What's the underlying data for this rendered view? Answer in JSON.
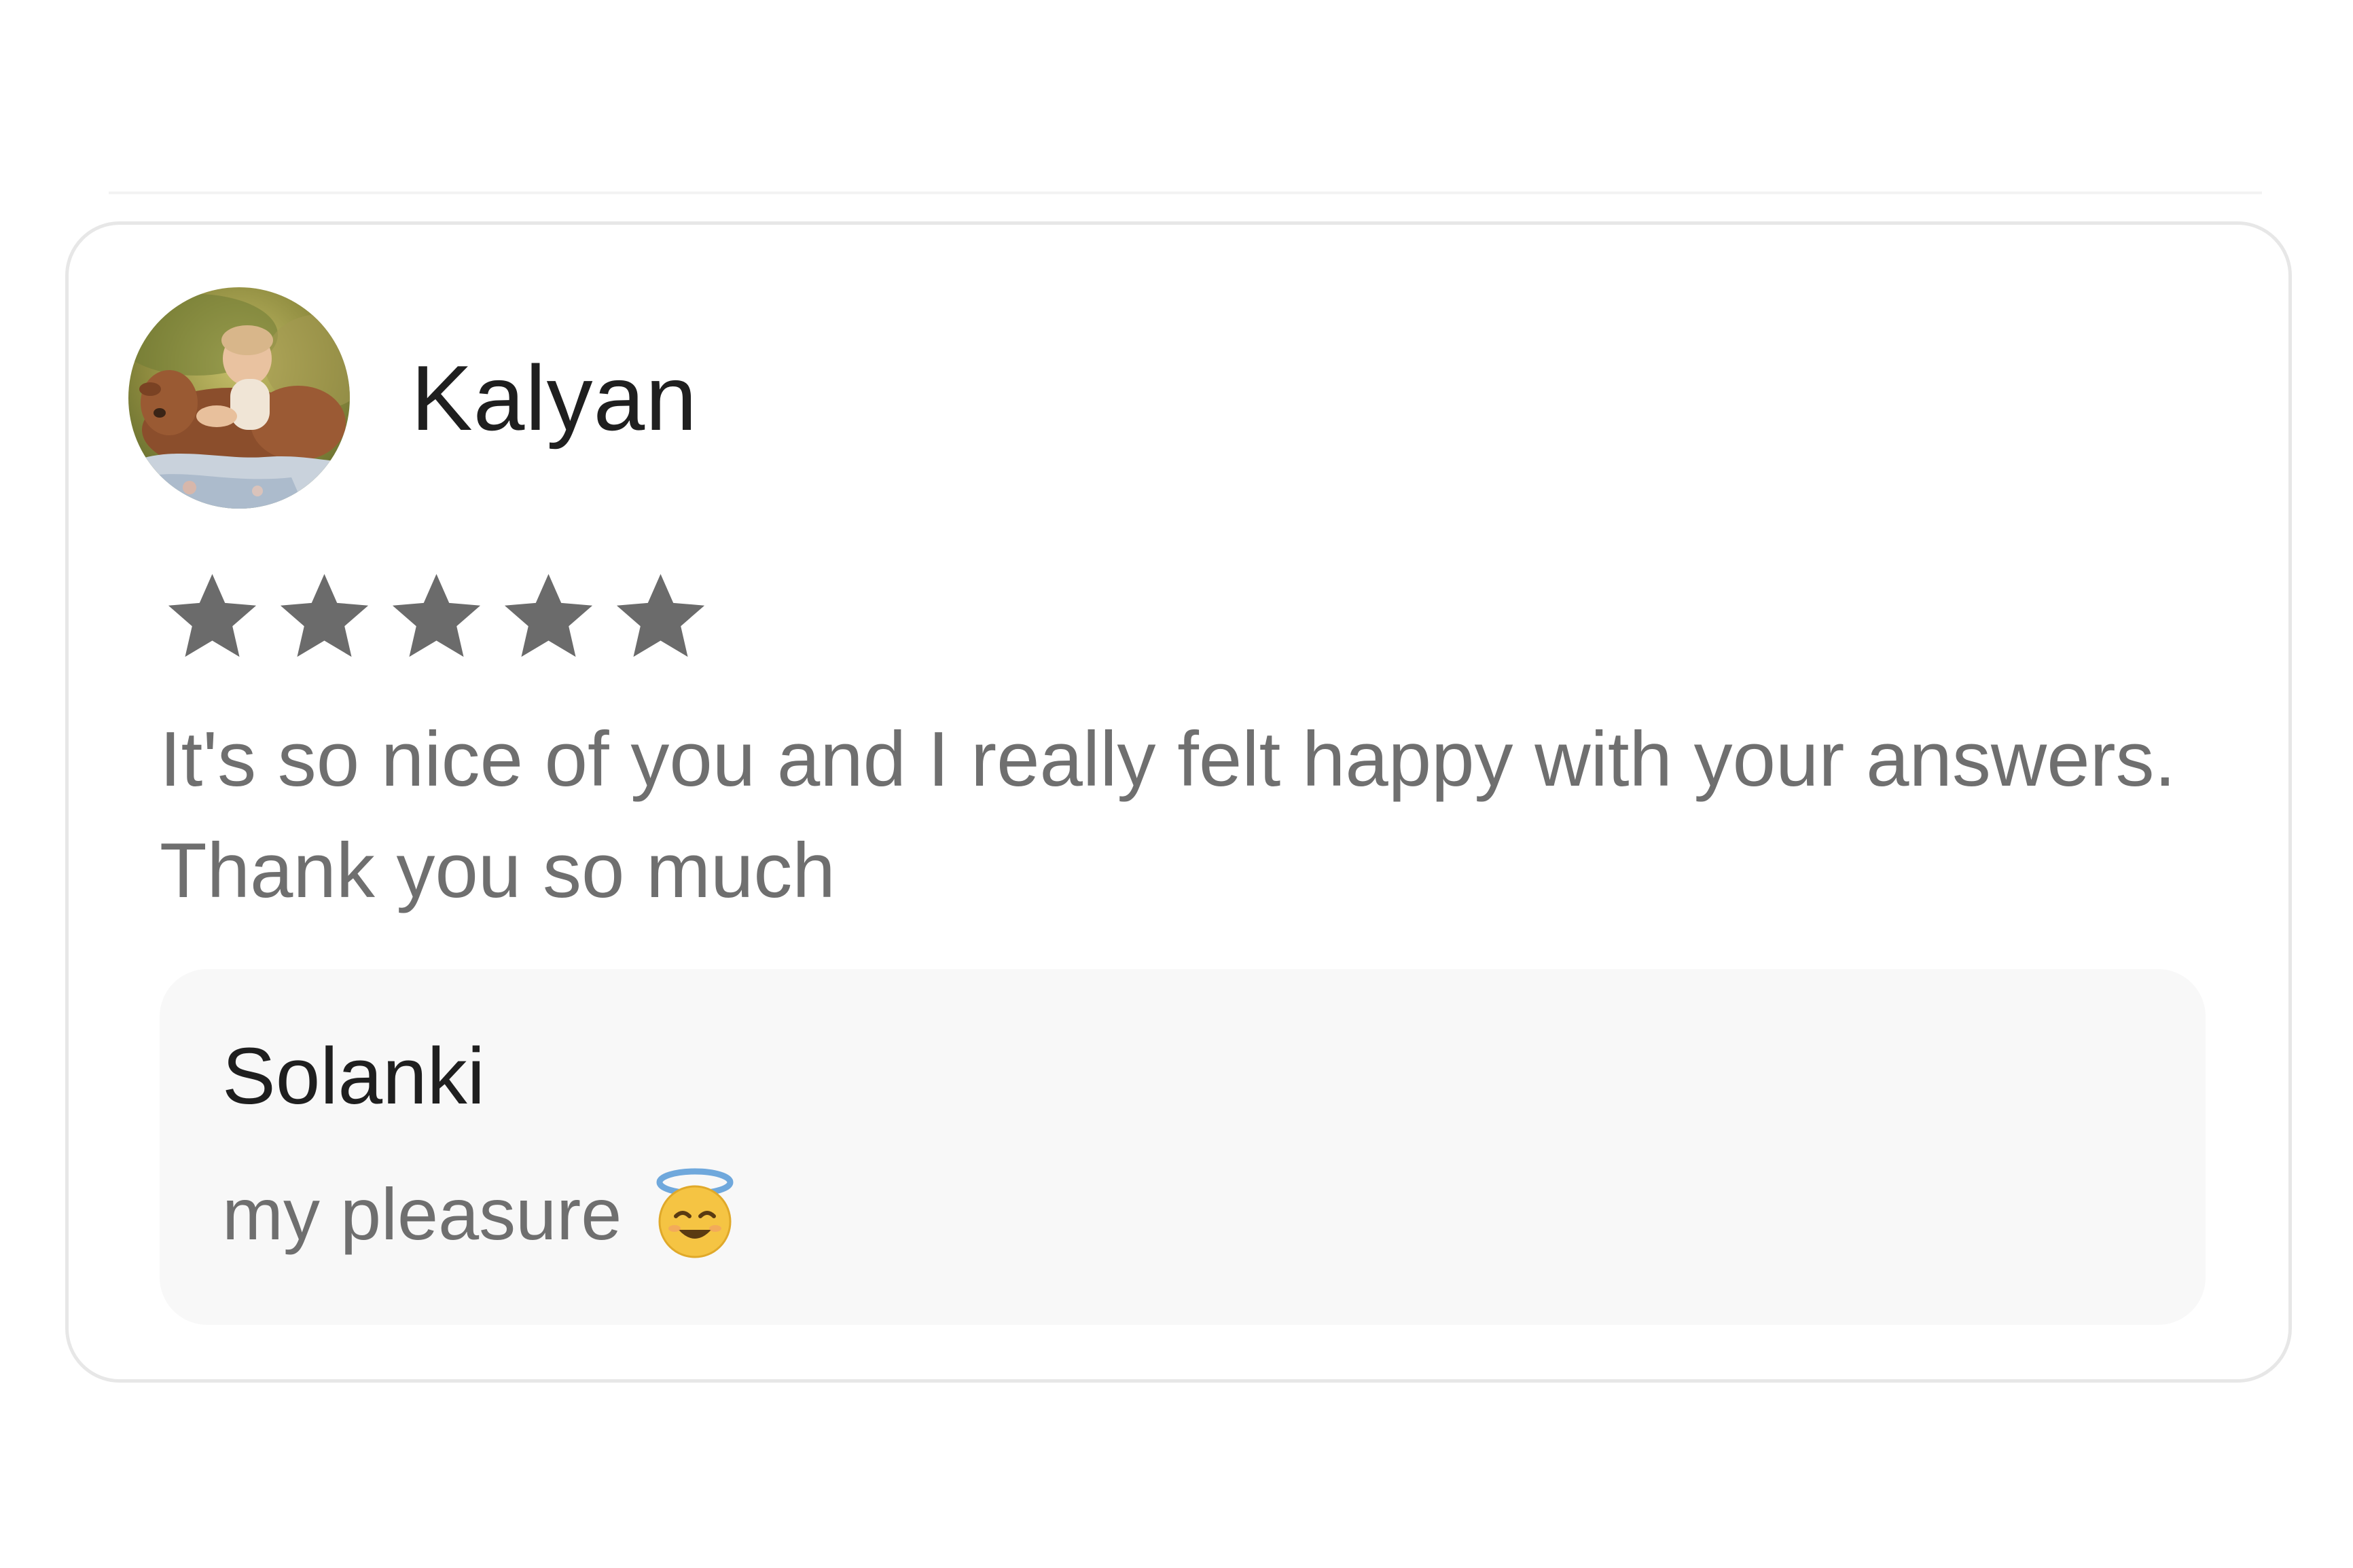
{
  "review": {
    "reviewer_name": "Kalyan",
    "rating": 5,
    "rating_max": 5,
    "star_color": "#6b6b6b",
    "text": "It's so nice of you and I really felt happy with your answers. Thank you so much",
    "avatar_icon": "avatar-photo",
    "reply": {
      "author": "Solanki",
      "message": "my pleasure",
      "emoji_icon": "smiling-face-with-halo"
    }
  },
  "colors": {
    "name_text": "#1f1f1f",
    "body_text": "#6f6f6f",
    "card_border": "#e7e7e7",
    "reply_background": "#f8f8f8"
  }
}
